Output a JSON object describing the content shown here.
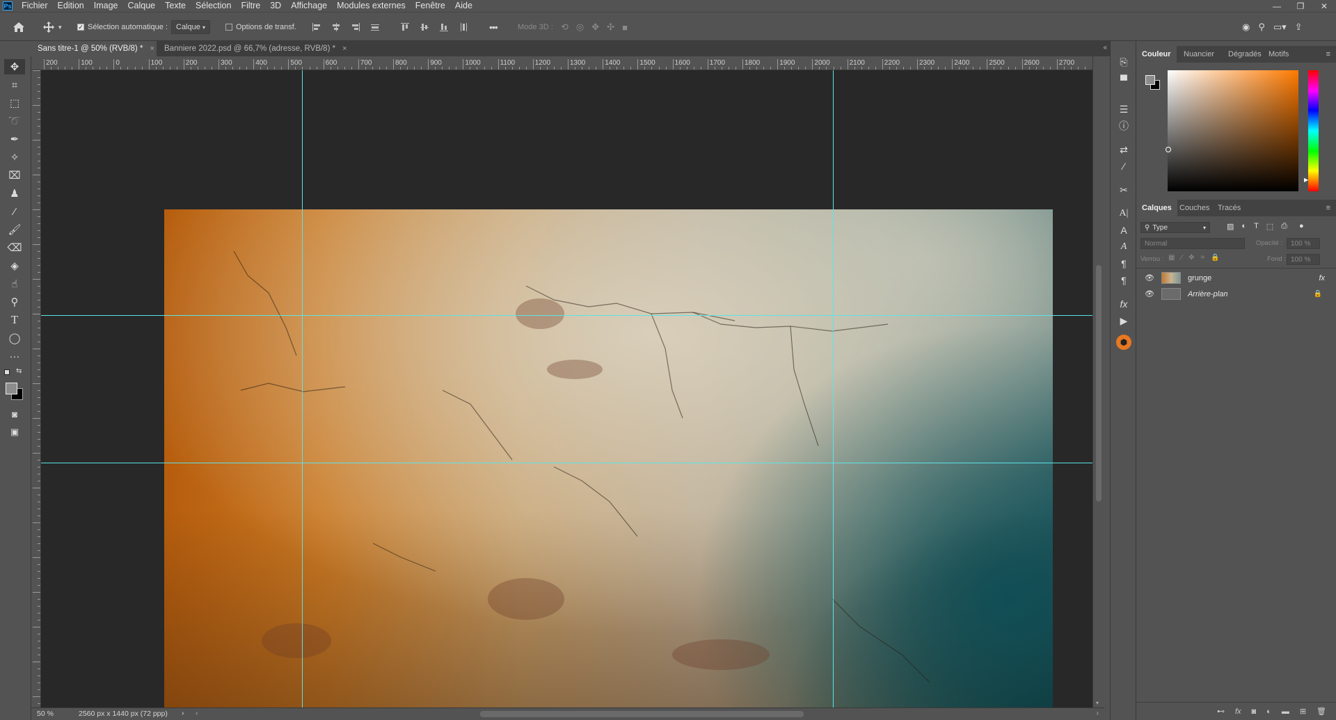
{
  "menu": [
    "Fichier",
    "Edition",
    "Image",
    "Calque",
    "Texte",
    "Sélection",
    "Filtre",
    "3D",
    "Affichage",
    "Modules externes",
    "Fenêtre",
    "Aide"
  ],
  "app_logo": "Ps",
  "window_controls": {
    "minimize": "—",
    "restore": "❐",
    "close": "✕"
  },
  "options": {
    "auto_select_label": "Sélection automatique :",
    "auto_select_value": "Calque",
    "transform_label": "Options de transf.",
    "more": "•••",
    "mode3d_label": "Mode 3D :"
  },
  "tabs": [
    {
      "label": "Sans titre-1 @ 50% (RVB/8) *",
      "close": "×"
    },
    {
      "label": "Banniere 2022.psd @ 66,7% (adresse, RVB/8) *",
      "close": "×"
    }
  ],
  "ruler_top_labels": [
    "200",
    "100",
    "0",
    "100",
    "200",
    "300",
    "400",
    "500",
    "600",
    "700",
    "800",
    "900",
    "1000",
    "1100",
    "1200",
    "1300",
    "1400",
    "1500",
    "1600",
    "1700",
    "1800",
    "1900",
    "2000",
    "2100",
    "2200",
    "2300",
    "2400",
    "2500",
    "2600",
    "2700"
  ],
  "status": {
    "zoom": "50 %",
    "doc_info": "2560 px x 1440 px (72 ppp)",
    "arrow": "›"
  },
  "color_panel": {
    "tabs": [
      "Couleur",
      "Nuancier",
      "Dégradés",
      "Motifs"
    ],
    "active": "Couleur"
  },
  "layers_panel": {
    "tabs": [
      "Calques",
      "Couches",
      "Tracés"
    ],
    "active": "Calques",
    "filter_label": "Type",
    "blend_mode": "Normal",
    "opacity_label": "Opacité :",
    "opacity_value": "100 %",
    "lock_label": "Verrou :",
    "fill_label": "Fond :",
    "fill_value": "100 %",
    "layers": [
      {
        "name": "grunge",
        "fx": "fx"
      },
      {
        "name": "Arrière-plan"
      }
    ]
  }
}
